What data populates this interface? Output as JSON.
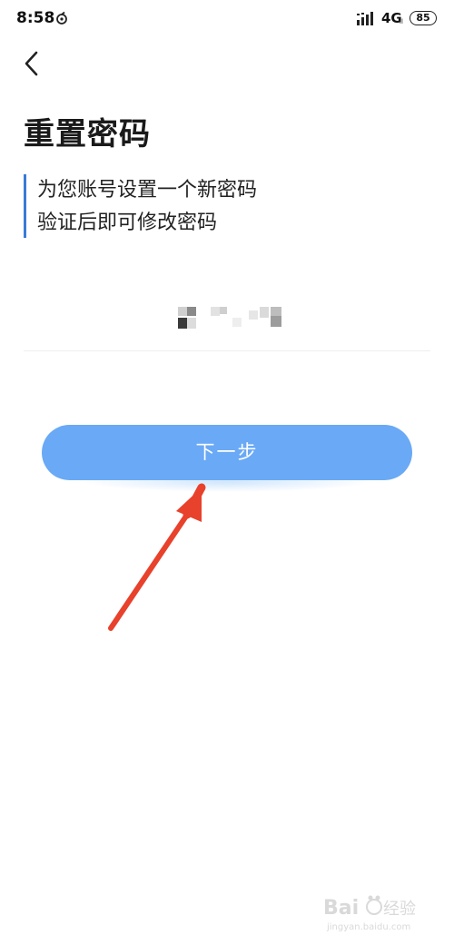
{
  "status_bar": {
    "time": "8:58",
    "network": "4G",
    "network_sub": "ıl",
    "battery": "85",
    "icons": [
      "app-notification-icon",
      "signal-icon",
      "battery-icon"
    ]
  },
  "header": {
    "back_icon": "chevron-left-icon"
  },
  "main": {
    "title": "重置密码",
    "description_lines": [
      "为您账号设置一个新密码",
      "验证后即可修改密码"
    ],
    "account_value": "",
    "next_button_label": "下一步"
  },
  "annotation": {
    "arrow_color": "#e8412c",
    "arrow_icon": "red-arrow-icon"
  },
  "colors": {
    "accent": "#3a7bd5",
    "button": "#6aa9f5",
    "button_text": "#ffffff"
  },
  "watermark": {
    "logo": "baidu-jingyan-logo"
  }
}
